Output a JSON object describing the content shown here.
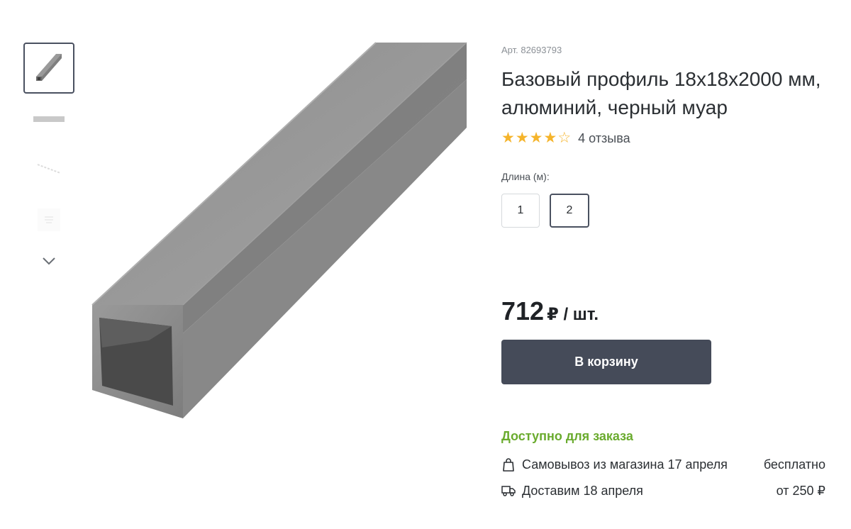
{
  "gallery": {
    "thumbnails": [
      {
        "icon": "profile-photo-thumb",
        "active": true
      },
      {
        "icon": "profile-bar-thumb",
        "active": false
      },
      {
        "icon": "profile-diagonal-thumb",
        "active": false
      },
      {
        "icon": "profile-drawing-thumb",
        "active": false
      }
    ],
    "next_icon": "chevron-down-icon"
  },
  "product": {
    "sku": "Арт. 82693793",
    "title": "Базовый профиль 18x18x2000 мм, алюминий, черный муар",
    "rating": 4,
    "reviews": "4 отзыва"
  },
  "length": {
    "label": "Длина (м):",
    "options": [
      "1",
      "2"
    ],
    "selected": "2"
  },
  "price": {
    "value": "712",
    "unit": "₽ / шт."
  },
  "cart": {
    "button_label": "В корзину"
  },
  "availability": {
    "status": "Доступно для заказа",
    "pickup": {
      "text": "Самовывоз из магазина 17 апреля",
      "cost": "бесплатно",
      "icon": "bag-icon"
    },
    "delivery": {
      "text": "Доставим 18 апреля",
      "cost": "от 250 ₽",
      "icon": "truck-icon"
    }
  },
  "colors": {
    "accent_dark": "#454b59",
    "available_green": "#6aab2e",
    "star": "#f5b42b"
  }
}
